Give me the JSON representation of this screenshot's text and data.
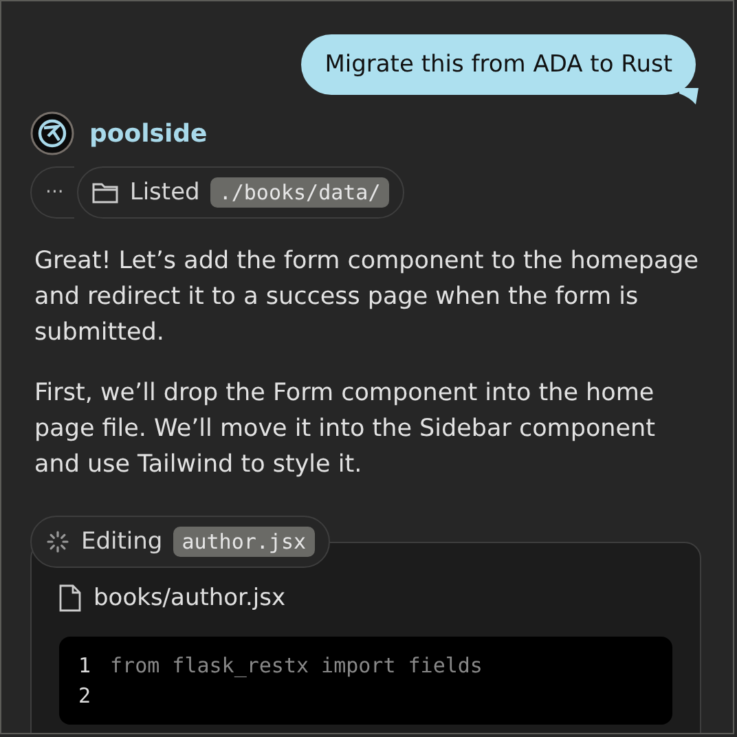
{
  "user_message": "Migrate this from ADA to Rust",
  "assistant": {
    "name": "poolside"
  },
  "actions": [
    {
      "kind": "more",
      "label": "···"
    },
    {
      "kind": "listed",
      "label": "Listed",
      "path": "./books/data/"
    }
  ],
  "paragraphs": [
    "Great! Let’s add the form component to the homepage and redirect it to a success page when the form is submitted.",
    "First, we’ll drop the Form component into the home page file. We’ll move it into the Sidebar component and use Tailwind to style it."
  ],
  "editing": {
    "label": "Editing",
    "file": "author.jsx",
    "path": "books/author.jsx",
    "lines": [
      {
        "number": "1",
        "code": "from flask_restx import fields"
      },
      {
        "number": "2"
      }
    ]
  }
}
